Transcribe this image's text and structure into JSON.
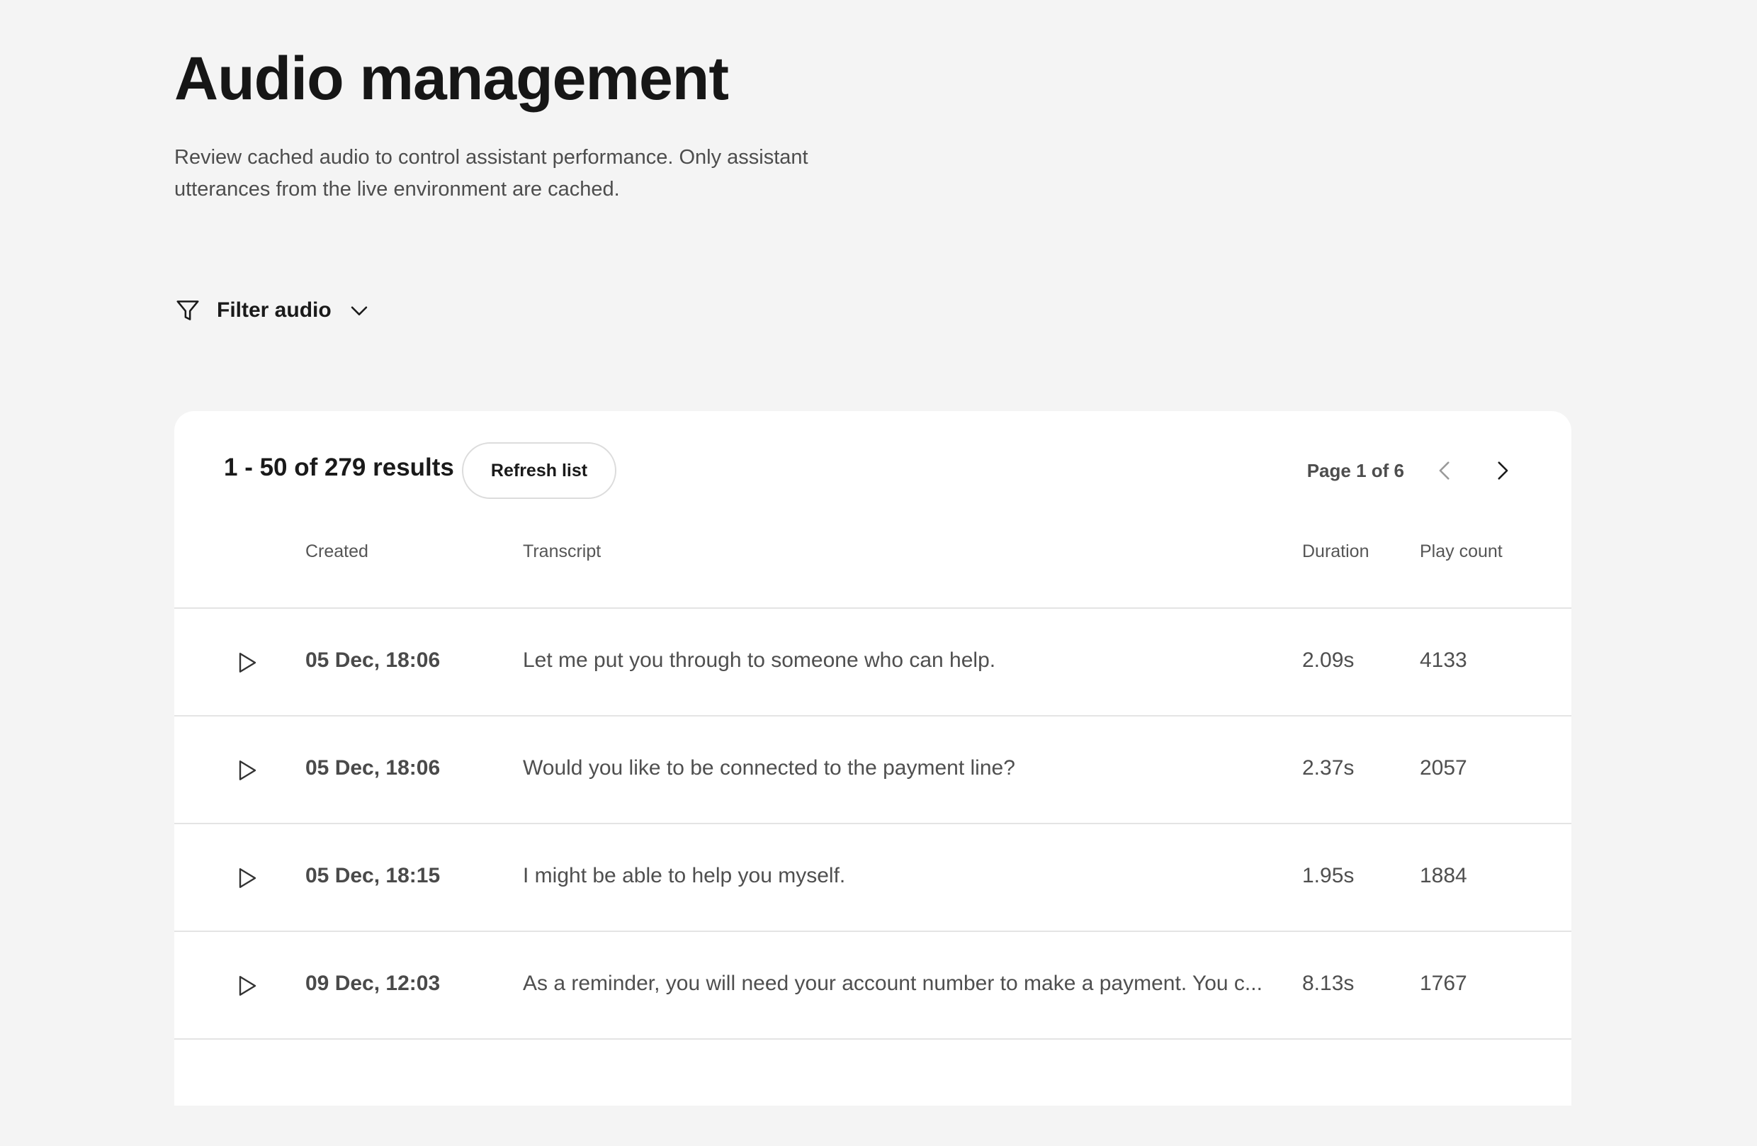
{
  "header": {
    "title": "Audio management",
    "description": "Review cached audio to control assistant performance. Only assistant utterances from the live environment are cached."
  },
  "filter": {
    "label": "Filter audio",
    "icon": "funnel-icon",
    "toggle_icon": "chevron-down-icon"
  },
  "results": {
    "summary": "1 - 50 of 279 results",
    "refresh_label": "Refresh list",
    "page_indicator": "Page 1 of 6"
  },
  "table": {
    "columns": {
      "created": "Created",
      "transcript": "Transcript",
      "duration": "Duration",
      "play_count": "Play count"
    },
    "rows": [
      {
        "created": "05 Dec, 18:06",
        "transcript": "Let me put you through to someone who can help.",
        "duration": "2.09s",
        "play_count": "4133"
      },
      {
        "created": "05 Dec, 18:06",
        "transcript": "Would you like to be connected to the payment line?",
        "duration": "2.37s",
        "play_count": "2057"
      },
      {
        "created": "05 Dec, 18:15",
        "transcript": "I might be able to help you myself.",
        "duration": "1.95s",
        "play_count": "1884"
      },
      {
        "created": "09 Dec, 12:03",
        "transcript": "As a reminder, you will need your account number to make a payment. You c...",
        "duration": "8.13s",
        "play_count": "1767"
      }
    ]
  },
  "colors": {
    "page_background": "#f4f4f4",
    "card_background": "#ffffff",
    "text_primary": "#1a1a1a",
    "text_secondary": "#4d4d4d",
    "divider": "#e4e4e4"
  }
}
